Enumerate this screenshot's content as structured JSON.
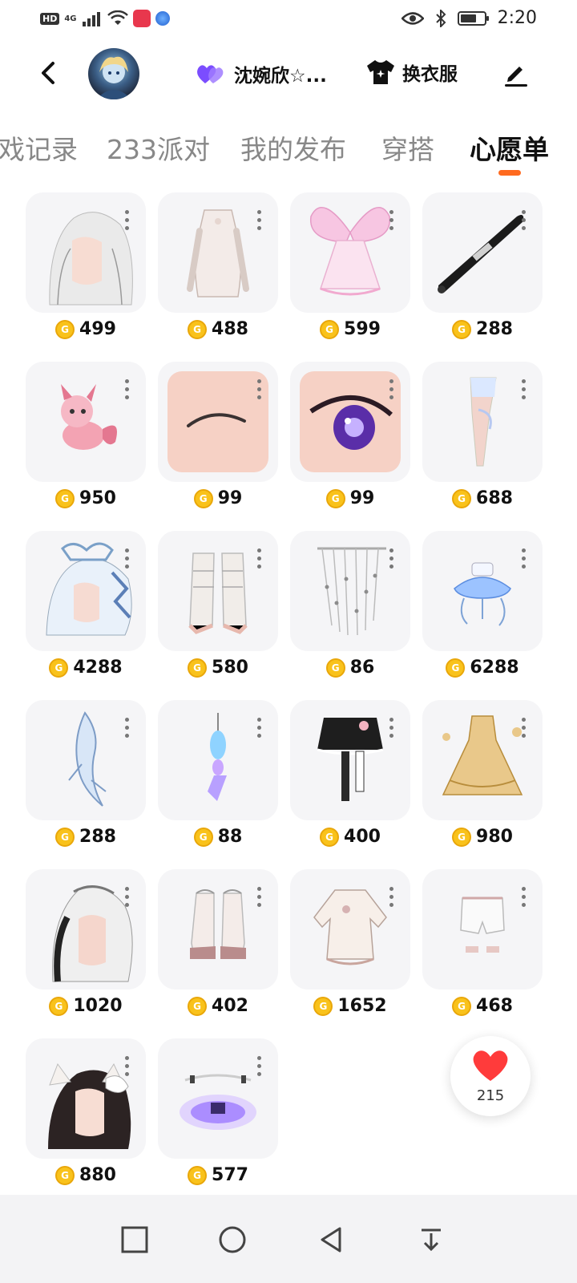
{
  "status_bar": {
    "left_hd": "HD",
    "left_net": "4G",
    "time": "2:20"
  },
  "header": {
    "user_name": "沈婉欣☆...",
    "outfit_label": "换衣服"
  },
  "tabs": [
    {
      "label": "戏记录",
      "active": false
    },
    {
      "label": "233派对",
      "active": false
    },
    {
      "label": "我的发布",
      "active": false
    },
    {
      "label": "穿搭",
      "active": false
    },
    {
      "label": "心愿单",
      "active": true
    }
  ],
  "wishlist": [
    {
      "icon": "white-hair-icon",
      "price": "499"
    },
    {
      "icon": "white-dress-icon",
      "price": "488"
    },
    {
      "icon": "butterfly-wings-dress-icon",
      "price": "599"
    },
    {
      "icon": "baseball-bat-icon",
      "price": "288"
    },
    {
      "icon": "pink-fox-pet-icon",
      "price": "950"
    },
    {
      "icon": "eyebrow-icon",
      "price": "99"
    },
    {
      "icon": "purple-eye-icon",
      "price": "99"
    },
    {
      "icon": "leg-stocking-icon",
      "price": "688"
    },
    {
      "icon": "ice-crown-hair-icon",
      "price": "4288"
    },
    {
      "icon": "lace-socks-icon",
      "price": "580"
    },
    {
      "icon": "bead-curtain-icon",
      "price": "86"
    },
    {
      "icon": "jellyfish-skirt-icon",
      "price": "6288"
    },
    {
      "icon": "crystal-wing-icon",
      "price": "288"
    },
    {
      "icon": "dreamcatcher-earring-icon",
      "price": "88"
    },
    {
      "icon": "black-lolita-skirt-icon",
      "price": "400"
    },
    {
      "icon": "golden-gown-icon",
      "price": "980"
    },
    {
      "icon": "silver-hair-icon",
      "price": "1020"
    },
    {
      "icon": "frilly-boots-icon",
      "price": "402"
    },
    {
      "icon": "cream-jacket-icon",
      "price": "1652"
    },
    {
      "icon": "white-shorts-icon",
      "price": "468"
    },
    {
      "icon": "bow-hair-icon",
      "price": "880"
    },
    {
      "icon": "glowing-circle-icon",
      "price": "577"
    }
  ],
  "like": {
    "count": "215"
  },
  "colors": {
    "accent": "#ff6a1f",
    "coin": "#f9c21b",
    "heart": "#ff3b3b",
    "badge": "#7b4dff"
  }
}
